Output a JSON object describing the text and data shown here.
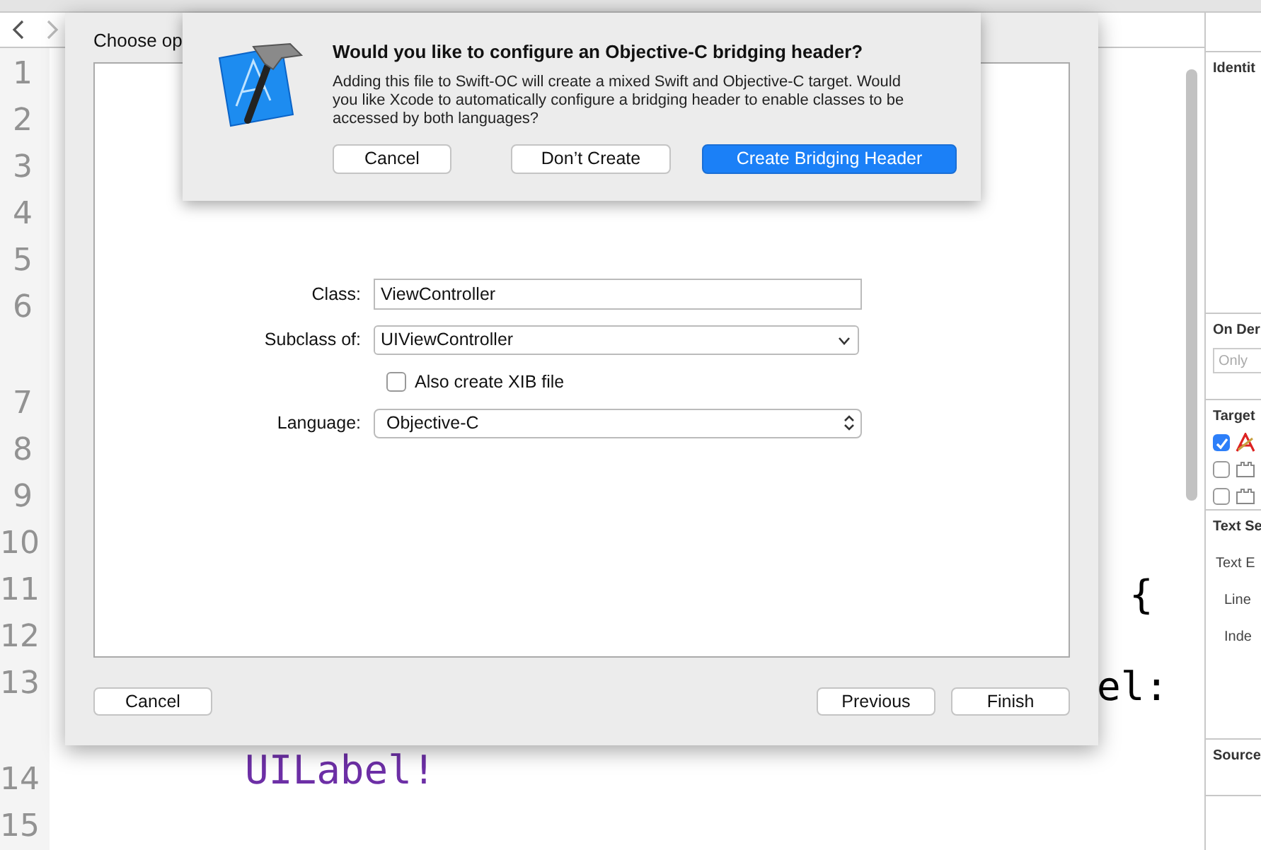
{
  "editor": {
    "lines": [
      {
        "number": "1",
        "wrapped": false
      },
      {
        "number": "2",
        "wrapped": false
      },
      {
        "number": "3",
        "wrapped": false
      },
      {
        "number": "4",
        "wrapped": false
      },
      {
        "number": "5",
        "wrapped": false
      },
      {
        "number": "6",
        "wrapped": true
      },
      {
        "number": "7",
        "wrapped": false
      },
      {
        "number": "8",
        "wrapped": false
      },
      {
        "number": "9",
        "wrapped": false
      },
      {
        "number": "10",
        "wrapped": false
      },
      {
        "number": "11",
        "wrapped": false
      },
      {
        "number": "12",
        "wrapped": false
      },
      {
        "number": "13",
        "wrapped": true
      },
      {
        "number": "14",
        "wrapped": false
      },
      {
        "number": "15",
        "wrapped": false
      }
    ],
    "code_fragments": [
      {
        "text": "{",
        "kind": "plain"
      },
      {
        "text": "el:",
        "kind": "plain"
      },
      {
        "text": "UILabel!",
        "kind": "type"
      }
    ]
  },
  "inspector": {
    "sections": [
      {
        "title": "Identit"
      },
      {
        "title": "On Der",
        "placeholder": "Only"
      },
      {
        "title": "Target",
        "targets": [
          {
            "checked": true,
            "kind": "app"
          },
          {
            "checked": false,
            "kind": "bundle"
          },
          {
            "checked": false,
            "kind": "bundle"
          }
        ]
      },
      {
        "title": "Text Se",
        "labels": [
          "Text E",
          "Line",
          "Inde"
        ]
      },
      {
        "title": "Source"
      }
    ]
  },
  "sheet": {
    "title": "Choose op",
    "class_label": "Class:",
    "class_value": "ViewController",
    "subclass_label": "Subclass of:",
    "subclass_value": "UIViewController",
    "xib": {
      "label": "Also create XIB file",
      "checked": false
    },
    "language_label": "Language:",
    "language_value": "Objective-C",
    "buttons": [
      "Cancel",
      "Previous",
      "Finish"
    ]
  },
  "alert": {
    "title": "Would you like to configure an Objective-C bridging header?",
    "message": "Adding this file to Swift-OC will create a mixed Swift and Objective-C target. Would you like Xcode to automatically configure a bridging header to enable classes to be accessed by both languages?",
    "buttons": [
      {
        "label": "Cancel",
        "default": false
      },
      {
        "label": "Don’t Create",
        "default": false
      },
      {
        "label": "Create Bridging Header",
        "default": true
      }
    ]
  }
}
